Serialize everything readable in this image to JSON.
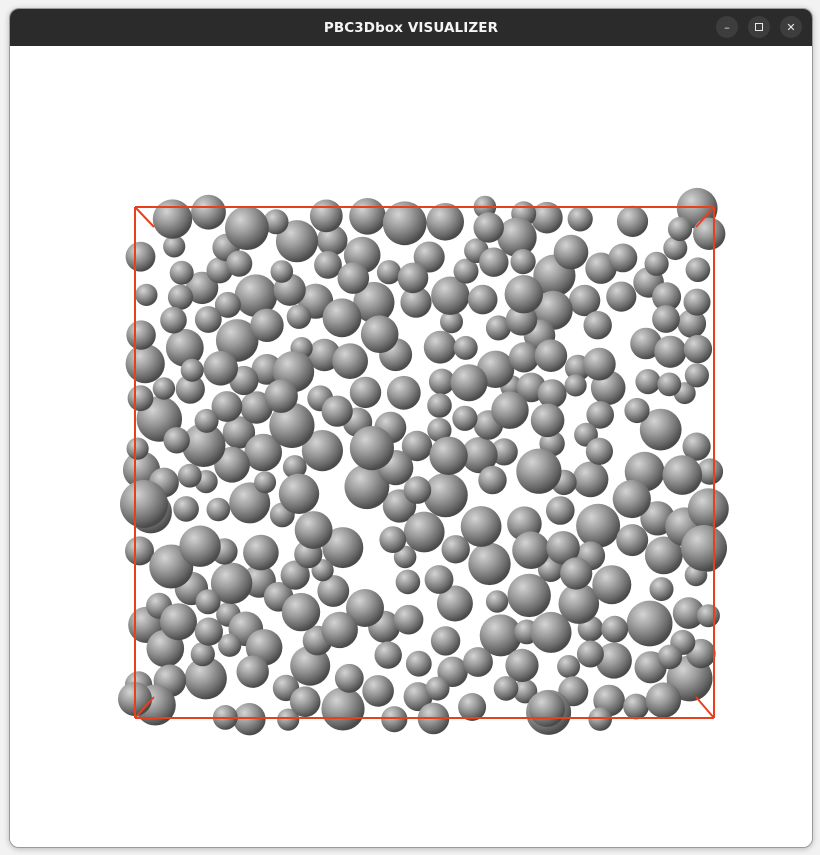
{
  "window": {
    "title": "PBC3Dbox VISUALIZER",
    "controls": {
      "minimize_icon": "minimize-icon",
      "maximize_icon": "maximize-icon",
      "close_icon": "close-icon"
    }
  },
  "scene": {
    "description_colors": {
      "sphere_light": "#c8c8c8",
      "sphere_mid": "#8a8a8a",
      "sphere_dark": "#4e4e4e",
      "box_edge": "#e8401c",
      "background": "#ffffff"
    }
  }
}
